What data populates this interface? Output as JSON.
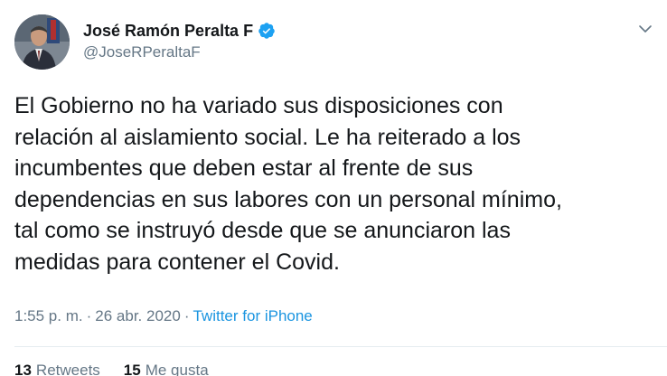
{
  "author": {
    "name": "José Ramón Peralta F",
    "handle": "@JoseRPeraltaF",
    "verified": true
  },
  "tweet": {
    "text": "El Gobierno no ha variado sus disposiciones con\nrelación al aislamiento social. Le ha reiterado a los\nincumbentes que deben estar al frente de sus\ndependencias en sus labores con un personal mínimo,\ntal como se instruyó desde que se anunciaron las\nmedidas para contener el Covid.",
    "time": "1:55 p. m.",
    "separator": "·",
    "date": "26 abr. 2020",
    "source": "Twitter for iPhone"
  },
  "stats": {
    "retweets_count": "13",
    "retweets_label": "Retweets",
    "likes_count": "15",
    "likes_label": "Me gusta"
  },
  "icons": {
    "verified": "verified-badge-icon",
    "more": "chevron-down-icon"
  },
  "colors": {
    "accent": "#1da1f2",
    "link": "#1b95e0",
    "muted": "#657786",
    "text": "#14171a"
  }
}
